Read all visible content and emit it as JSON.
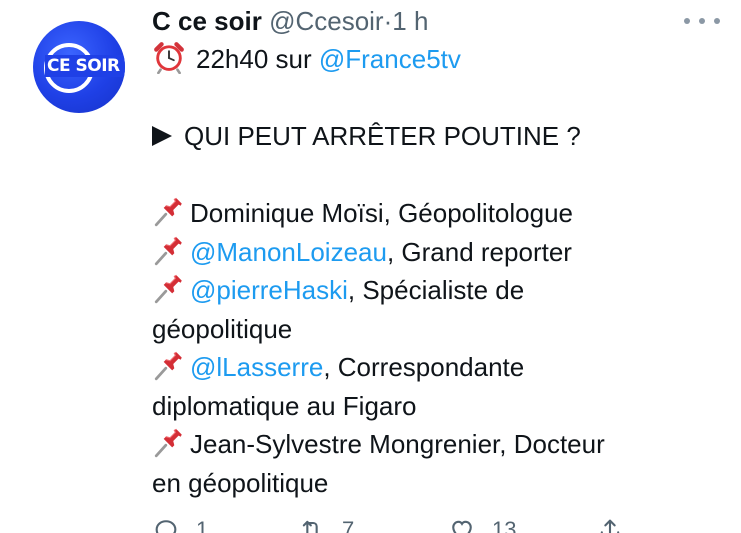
{
  "tweet": {
    "display_name": "C ce soir",
    "handle": "@Ccesoir",
    "separator": "·",
    "time": "1 h",
    "avatar_text": "CE SOIR",
    "lines": [
      {
        "kind": "alarm",
        "text": "22h40 sur ",
        "mention": "@France5tv",
        "rest": ""
      },
      {
        "kind": "blank"
      },
      {
        "kind": "arrow",
        "text": "QUI PEUT ARRÊTER POUTINE ?"
      },
      {
        "kind": "blank"
      },
      {
        "kind": "pin",
        "text": "Dominique Moïsi, Géopolitologue"
      },
      {
        "kind": "pin",
        "mention": "@ManonLoizeau",
        "rest": ", Grand reporter"
      },
      {
        "kind": "pin",
        "mention": "@pierreHaski",
        "rest": ", Spécialiste de"
      },
      {
        "kind": "plain",
        "text": "géopolitique"
      },
      {
        "kind": "pin",
        "mention": "@lLasserre",
        "rest": ", Correspondante"
      },
      {
        "kind": "plain",
        "text": "diplomatique au Figaro"
      },
      {
        "kind": "pin",
        "text": "Jean-Sylvestre Mongrenier, Docteur"
      },
      {
        "kind": "plain",
        "text": "en géopolitique"
      }
    ],
    "actions": {
      "reply_count": "1",
      "retweet_count": "7",
      "like_count": "13"
    }
  },
  "colors": {
    "mention": "#1d9bf0",
    "secondary_text": "#536471",
    "avatar_bg": "#1f40e6"
  },
  "icons": {
    "alarm": "alarm-clock-icon",
    "pin": "pushpin-icon",
    "arrow": "play-arrow-icon",
    "more": "more-dots-icon",
    "reply": "reply-icon",
    "retweet": "retweet-icon",
    "like": "heart-icon",
    "share": "share-icon"
  }
}
